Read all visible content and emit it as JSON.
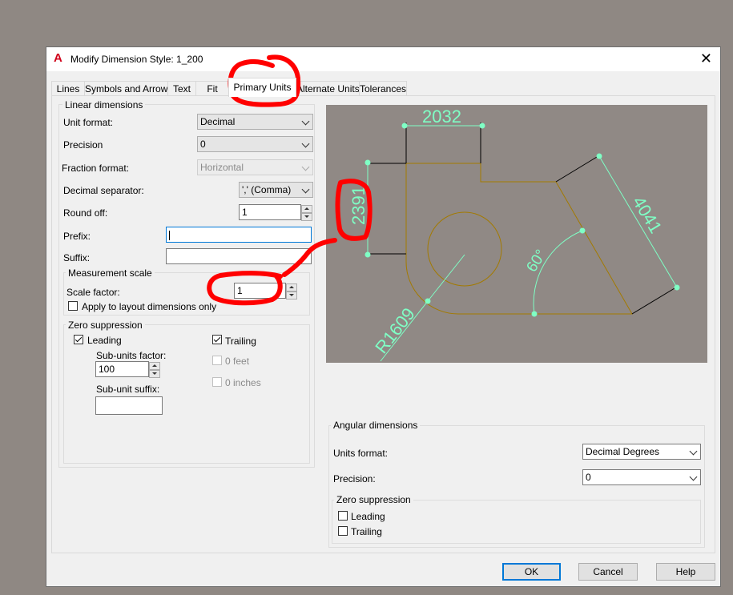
{
  "dialog": {
    "title": "Modify Dimension Style: 1_200",
    "close_icon": "close-icon"
  },
  "tabs": [
    {
      "label": "Lines"
    },
    {
      "label": "Symbols and Arrows"
    },
    {
      "label": "Text"
    },
    {
      "label": "Fit"
    },
    {
      "label": "Primary Units",
      "active": true
    },
    {
      "label": "Alternate Units"
    },
    {
      "label": "Tolerances"
    }
  ],
  "linear": {
    "legend": "Linear dimensions",
    "unit_format_label": "Unit format:",
    "unit_format_value": "Decimal",
    "precision_label": "Precision",
    "precision_value": "0",
    "fraction_format_label": "Fraction format:",
    "fraction_format_value": "Horizontal",
    "decimal_separator_label": "Decimal separator:",
    "decimal_separator_value": "',' (Comma)",
    "round_off_label": "Round off:",
    "round_off_value": "1",
    "prefix_label": "Prefix:",
    "prefix_value": "",
    "suffix_label": "Suffix:",
    "suffix_value": ""
  },
  "measurement_scale": {
    "legend": "Measurement scale",
    "scale_factor_label": "Scale factor:",
    "scale_factor_value": "1",
    "apply_layout_label": "Apply to layout dimensions only",
    "apply_layout_checked": false
  },
  "zero_suppression": {
    "legend": "Zero suppression",
    "leading_label": "Leading",
    "leading_checked": true,
    "trailing_label": "Trailing",
    "trailing_checked": true,
    "sub_units_factor_label": "Sub-units factor:",
    "sub_units_factor_value": "100",
    "sub_unit_suffix_label": "Sub-unit suffix:",
    "sub_unit_suffix_value": "",
    "zero_feet_label": "0 feet",
    "zero_inches_label": "0 inches"
  },
  "preview": {
    "dim_horizontal": "2032",
    "dim_vertical": "2391",
    "dim_aligned": "4041",
    "dim_angle": "60°",
    "dim_radius": "R1609",
    "background": "#908985",
    "dim_color": "#7fffc5",
    "geometry_color": "#a37a00"
  },
  "angular": {
    "legend": "Angular dimensions",
    "units_format_label": "Units format:",
    "units_format_value": "Decimal Degrees",
    "precision_label": "Precision:",
    "precision_value": "0",
    "zero_suppression_legend": "Zero suppression",
    "leading_label": "Leading",
    "leading_checked": false,
    "trailing_label": "Trailing",
    "trailing_checked": false
  },
  "buttons": {
    "ok": "OK",
    "cancel": "Cancel",
    "help": "Help"
  },
  "colors": {
    "annotation_red": "#ff0000",
    "focus_blue": "#0078d7",
    "app_icon_red": "#d0021b"
  }
}
